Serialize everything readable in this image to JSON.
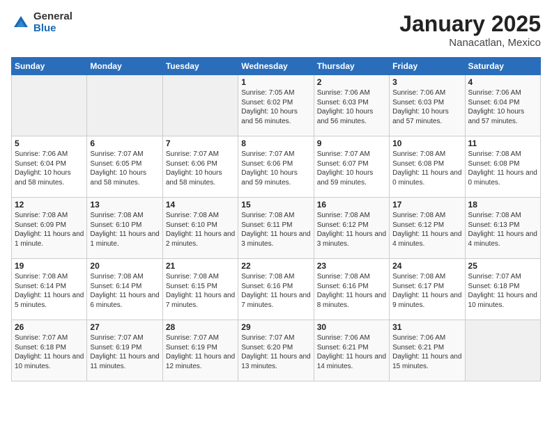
{
  "logo": {
    "general": "General",
    "blue": "Blue"
  },
  "title": "January 2025",
  "subtitle": "Nanacatlan, Mexico",
  "days_of_week": [
    "Sunday",
    "Monday",
    "Tuesday",
    "Wednesday",
    "Thursday",
    "Friday",
    "Saturday"
  ],
  "weeks": [
    [
      {
        "num": "",
        "info": ""
      },
      {
        "num": "",
        "info": ""
      },
      {
        "num": "",
        "info": ""
      },
      {
        "num": "1",
        "info": "Sunrise: 7:05 AM\nSunset: 6:02 PM\nDaylight: 10 hours and 56 minutes."
      },
      {
        "num": "2",
        "info": "Sunrise: 7:06 AM\nSunset: 6:03 PM\nDaylight: 10 hours and 56 minutes."
      },
      {
        "num": "3",
        "info": "Sunrise: 7:06 AM\nSunset: 6:03 PM\nDaylight: 10 hours and 57 minutes."
      },
      {
        "num": "4",
        "info": "Sunrise: 7:06 AM\nSunset: 6:04 PM\nDaylight: 10 hours and 57 minutes."
      }
    ],
    [
      {
        "num": "5",
        "info": "Sunrise: 7:06 AM\nSunset: 6:04 PM\nDaylight: 10 hours and 58 minutes."
      },
      {
        "num": "6",
        "info": "Sunrise: 7:07 AM\nSunset: 6:05 PM\nDaylight: 10 hours and 58 minutes."
      },
      {
        "num": "7",
        "info": "Sunrise: 7:07 AM\nSunset: 6:06 PM\nDaylight: 10 hours and 58 minutes."
      },
      {
        "num": "8",
        "info": "Sunrise: 7:07 AM\nSunset: 6:06 PM\nDaylight: 10 hours and 59 minutes."
      },
      {
        "num": "9",
        "info": "Sunrise: 7:07 AM\nSunset: 6:07 PM\nDaylight: 10 hours and 59 minutes."
      },
      {
        "num": "10",
        "info": "Sunrise: 7:08 AM\nSunset: 6:08 PM\nDaylight: 11 hours and 0 minutes."
      },
      {
        "num": "11",
        "info": "Sunrise: 7:08 AM\nSunset: 6:08 PM\nDaylight: 11 hours and 0 minutes."
      }
    ],
    [
      {
        "num": "12",
        "info": "Sunrise: 7:08 AM\nSunset: 6:09 PM\nDaylight: 11 hours and 1 minute."
      },
      {
        "num": "13",
        "info": "Sunrise: 7:08 AM\nSunset: 6:10 PM\nDaylight: 11 hours and 1 minute."
      },
      {
        "num": "14",
        "info": "Sunrise: 7:08 AM\nSunset: 6:10 PM\nDaylight: 11 hours and 2 minutes."
      },
      {
        "num": "15",
        "info": "Sunrise: 7:08 AM\nSunset: 6:11 PM\nDaylight: 11 hours and 3 minutes."
      },
      {
        "num": "16",
        "info": "Sunrise: 7:08 AM\nSunset: 6:12 PM\nDaylight: 11 hours and 3 minutes."
      },
      {
        "num": "17",
        "info": "Sunrise: 7:08 AM\nSunset: 6:12 PM\nDaylight: 11 hours and 4 minutes."
      },
      {
        "num": "18",
        "info": "Sunrise: 7:08 AM\nSunset: 6:13 PM\nDaylight: 11 hours and 4 minutes."
      }
    ],
    [
      {
        "num": "19",
        "info": "Sunrise: 7:08 AM\nSunset: 6:14 PM\nDaylight: 11 hours and 5 minutes."
      },
      {
        "num": "20",
        "info": "Sunrise: 7:08 AM\nSunset: 6:14 PM\nDaylight: 11 hours and 6 minutes."
      },
      {
        "num": "21",
        "info": "Sunrise: 7:08 AM\nSunset: 6:15 PM\nDaylight: 11 hours and 7 minutes."
      },
      {
        "num": "22",
        "info": "Sunrise: 7:08 AM\nSunset: 6:16 PM\nDaylight: 11 hours and 7 minutes."
      },
      {
        "num": "23",
        "info": "Sunrise: 7:08 AM\nSunset: 6:16 PM\nDaylight: 11 hours and 8 minutes."
      },
      {
        "num": "24",
        "info": "Sunrise: 7:08 AM\nSunset: 6:17 PM\nDaylight: 11 hours and 9 minutes."
      },
      {
        "num": "25",
        "info": "Sunrise: 7:07 AM\nSunset: 6:18 PM\nDaylight: 11 hours and 10 minutes."
      }
    ],
    [
      {
        "num": "26",
        "info": "Sunrise: 7:07 AM\nSunset: 6:18 PM\nDaylight: 11 hours and 10 minutes."
      },
      {
        "num": "27",
        "info": "Sunrise: 7:07 AM\nSunset: 6:19 PM\nDaylight: 11 hours and 11 minutes."
      },
      {
        "num": "28",
        "info": "Sunrise: 7:07 AM\nSunset: 6:19 PM\nDaylight: 11 hours and 12 minutes."
      },
      {
        "num": "29",
        "info": "Sunrise: 7:07 AM\nSunset: 6:20 PM\nDaylight: 11 hours and 13 minutes."
      },
      {
        "num": "30",
        "info": "Sunrise: 7:06 AM\nSunset: 6:21 PM\nDaylight: 11 hours and 14 minutes."
      },
      {
        "num": "31",
        "info": "Sunrise: 7:06 AM\nSunset: 6:21 PM\nDaylight: 11 hours and 15 minutes."
      },
      {
        "num": "",
        "info": ""
      }
    ]
  ]
}
